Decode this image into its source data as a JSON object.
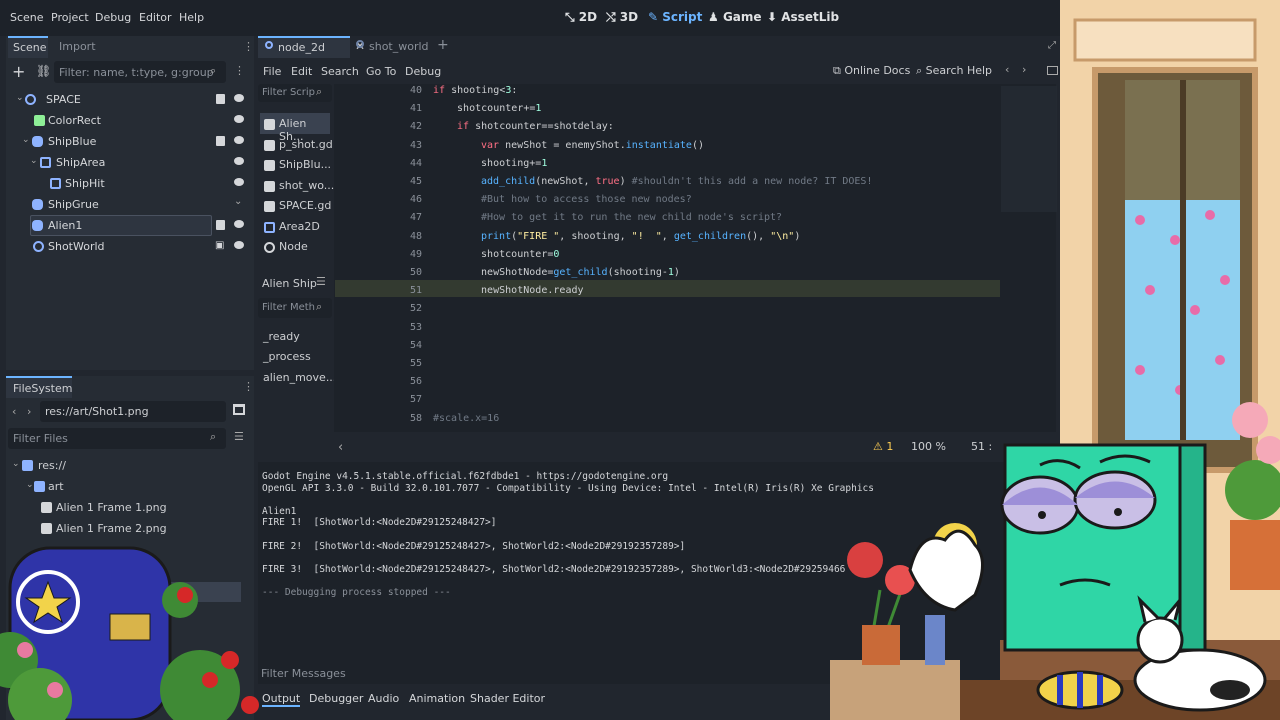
{
  "menu": {
    "scene": "Scene",
    "project": "Project",
    "debug": "Debug",
    "editor": "Editor",
    "help": "Help"
  },
  "workspaces": {
    "w2d": "2D",
    "w3d": "3D",
    "script": "Script",
    "game": "Game",
    "assetlib": "AssetLib"
  },
  "dock": {
    "scene_tab": "Scene",
    "import_tab": "Import",
    "filter_placeholder": "Filter: name, t:type, g:group",
    "tree": [
      {
        "label": "SPACE"
      },
      {
        "label": "ColorRect"
      },
      {
        "label": "ShipBlue"
      },
      {
        "label": "ShipArea"
      },
      {
        "label": "ShipHit"
      },
      {
        "label": "ShipGrue"
      },
      {
        "label": "Alien1"
      },
      {
        "label": "ShotWorld"
      }
    ]
  },
  "filesystem": {
    "title": "FileSystem",
    "path": "res://art/Shot1.png",
    "filter_placeholder": "Filter Files",
    "items": [
      {
        "label": "res://"
      },
      {
        "label": "art"
      },
      {
        "label": "Alien 1 Frame 1.png"
      },
      {
        "label": "Alien 1 Frame 2.png"
      }
    ]
  },
  "tabs": {
    "node_2d": "node_2d",
    "shot_world": "shot_world"
  },
  "script_menu": {
    "file": "File",
    "edit": "Edit",
    "search": "Search",
    "goto": "Go To",
    "debug": "Debug",
    "online_docs": "Online Docs",
    "search_help": "Search Help"
  },
  "script_list": {
    "filter_placeholder": "Filter Scrip",
    "items": [
      {
        "label": "Alien Sh..."
      },
      {
        "label": "p_shot.gd"
      },
      {
        "label": "ShipBlu..."
      },
      {
        "label": "shot_wo..."
      },
      {
        "label": "SPACE.gd"
      },
      {
        "label": "Area2D"
      },
      {
        "label": "Node"
      }
    ],
    "class_label": "Alien Ship",
    "methods_placeholder": "Filter Meth",
    "methods": [
      {
        "label": "_ready"
      },
      {
        "label": "_process"
      },
      {
        "label": "alien_move..."
      }
    ]
  },
  "code": {
    "lines": [
      {
        "n": "40",
        "t": "if shooting<3:"
      },
      {
        "n": "41",
        "t": "shotcounter+=1"
      },
      {
        "n": "42",
        "t": "if shotcounter==shotdelay:"
      },
      {
        "n": "43",
        "t": "var newShot = enemyShot.instantiate()"
      },
      {
        "n": "44",
        "t": "shooting+=1"
      },
      {
        "n": "45",
        "t": "add_child(newShot, true) #shouldn't this add a new node? IT DOES!"
      },
      {
        "n": "46",
        "t": "#But how to access those new nodes?"
      },
      {
        "n": "47",
        "t": "#How to get it to run the new child node's script?"
      },
      {
        "n": "48",
        "t": "print(\"FIRE \", shooting, \"!  \", get_children(), \"\\n\")"
      },
      {
        "n": "49",
        "t": "shotcounter=0"
      },
      {
        "n": "50",
        "t": "newShotNode=get_child(shooting-1)"
      },
      {
        "n": "51",
        "t": "newShotNode.ready"
      },
      {
        "n": "52",
        "t": ""
      },
      {
        "n": "53",
        "t": ""
      },
      {
        "n": "54",
        "t": ""
      },
      {
        "n": "55",
        "t": ""
      },
      {
        "n": "56",
        "t": ""
      },
      {
        "n": "57",
        "t": ""
      },
      {
        "n": "58",
        "t": "#scale.x=16"
      }
    ],
    "status": {
      "warnings": "1",
      "zoom": "100 %",
      "position": "51 :"
    }
  },
  "output": {
    "lines": [
      "Godot Engine v4.5.1.stable.official.f62fdbde1 - https://godotengine.org",
      "OpenGL API 3.3.0 - Build 32.0.101.7077 - Compatibility - Using Device: Intel - Intel(R) Iris(R) Xe Graphics",
      "",
      "Alien1",
      "FIRE 1!  [ShotWorld:<Node2D#29125248427>]",
      "",
      "FIRE 2!  [ShotWorld:<Node2D#29125248427>, ShotWorld2:<Node2D#29192357289>]",
      "",
      "FIRE 3!  [ShotWorld:<Node2D#29125248427>, ShotWorld2:<Node2D#29192357289>, ShotWorld3:<Node2D#29259466",
      "",
      "--- Debugging process stopped ---"
    ],
    "filter_placeholder": "Filter Messages"
  },
  "bottom_tabs": {
    "output": "Output",
    "debugger": "Debugger",
    "audio": "Audio",
    "animation": "Animation",
    "shader": "Shader Editor"
  },
  "colors": {
    "accent": "#6cb4ff",
    "bg": "#21262e",
    "panel": "#262c34"
  }
}
